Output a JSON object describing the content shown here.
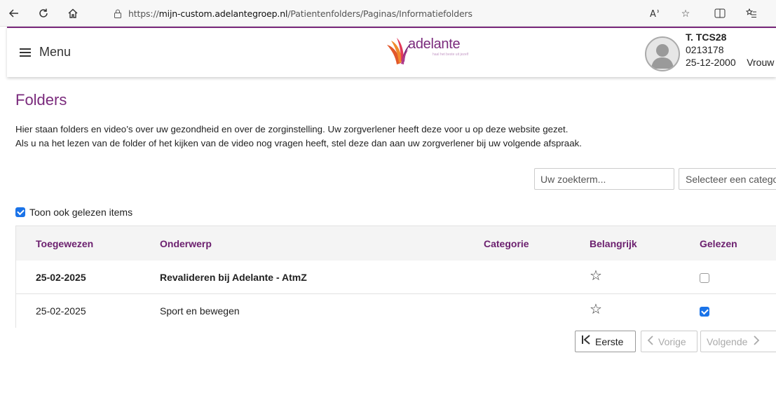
{
  "browser": {
    "url_prefix": "https://",
    "url_host": "mijn-custom.adelantegroep.nl",
    "url_path": "/Patientenfolders/Paginas/Informatiefolders"
  },
  "header": {
    "menu_label": "Menu",
    "logo_text": "adelante",
    "logo_tagline": "haal het beste uit jezelf",
    "patient": {
      "name": "T. TCS28",
      "id": "0213178",
      "birthdate": "25-12-2000",
      "gender": "Vrouw"
    }
  },
  "page": {
    "title": "Folders",
    "intro_line1": "Hier staan folders en video’s over uw gezondheid en over de zorginstelling. Uw zorgverlener heeft deze voor u op deze website gezet.",
    "intro_line2": "Als u na het lezen van de folder of het kijken van de video nog vragen heeft, stel deze dan aan uw zorgverlener bij uw volgende afspraak."
  },
  "filters": {
    "search_placeholder": "Uw zoekterm...",
    "category_placeholder": "Selecteer een categorie",
    "show_read_label": "Toon ook gelezen items",
    "show_read_checked": true
  },
  "table": {
    "columns": [
      "Toegewezen",
      "Onderwerp",
      "Categorie",
      "Belangrijk",
      "Gelezen"
    ],
    "rows": [
      {
        "assigned": "25-02-2025",
        "subject": "Revalideren bij Adelante - AtmZ",
        "category": "",
        "important": false,
        "read": false
      },
      {
        "assigned": "25-02-2025",
        "subject": "Sport en bewegen",
        "category": "",
        "important": false,
        "read": true
      }
    ]
  },
  "pagination": {
    "first_label": "Eerste",
    "prev_label": "Vorige",
    "next_label": "Volgende"
  },
  "colors": {
    "brand": "#7a2a7c",
    "checkbox_checked": "#1a73e8"
  }
}
